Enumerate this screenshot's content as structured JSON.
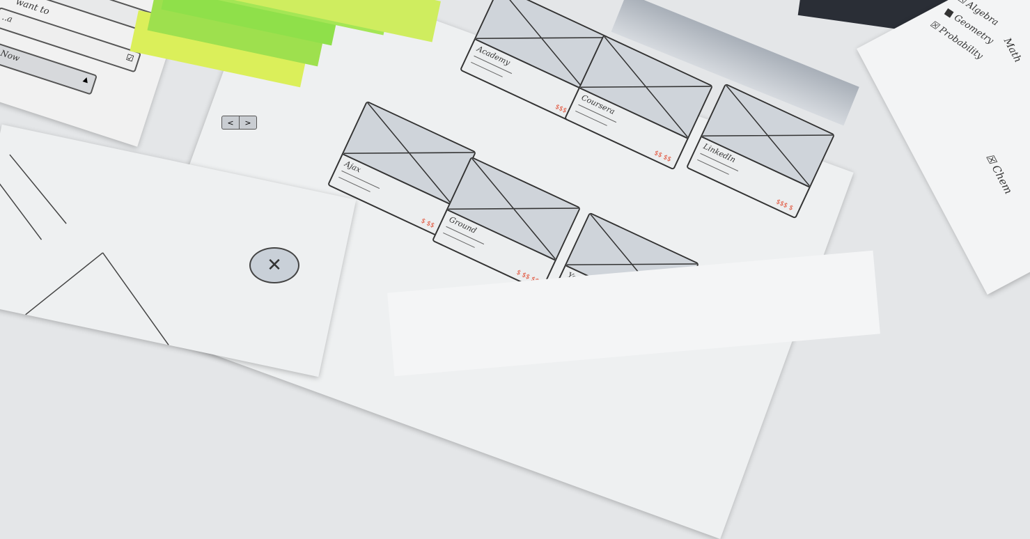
{
  "left_form": {
    "label_1": "want to",
    "field_2_text": "..a",
    "dropdown_text": "Now"
  },
  "nav_buttons": {
    "prev": "<",
    "next": ">"
  },
  "cards": [
    {
      "title": "Academy",
      "price": "$$$"
    },
    {
      "title": "Coursera",
      "price": "$$ $$"
    },
    {
      "title": "LinkedIn",
      "price": "$$$ $"
    },
    {
      "title": "Ajax",
      "price": "$ $$"
    },
    {
      "title": "Ground",
      "price": "$ $$ $$"
    },
    {
      "title": "Youtube",
      "price": ""
    }
  ],
  "filter_list": {
    "heading": "Math",
    "items": [
      "Algebra",
      "Geometry",
      "Probability"
    ],
    "second_item": "Chem"
  },
  "close_icon": "close-x-circle",
  "colors": {
    "sticky_green": "#8fe04a",
    "sticky_yellow": "#dbef5a",
    "price_red": "#e0452a"
  }
}
